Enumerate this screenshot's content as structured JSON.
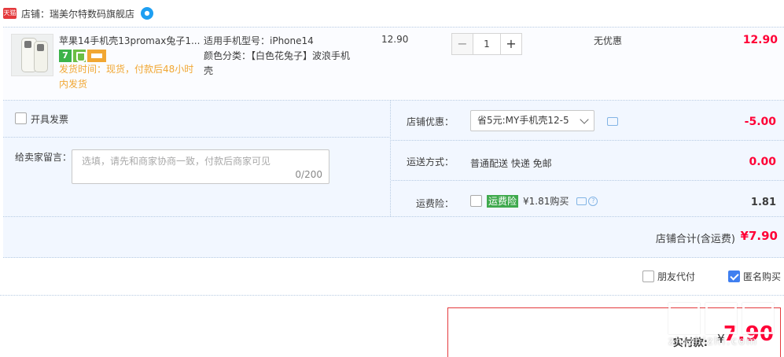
{
  "shop": {
    "badge": "天猫",
    "label": "店铺：瑞美尔特数码旗舰店",
    "wangwang_icon": "chat-bubble-icon"
  },
  "item": {
    "title": "苹果14手机壳13promax兔子1...",
    "badge_7": "7",
    "ship_time": "发货时间：现货，付款后48小时内发货",
    "attr_model": "适用手机型号：iPhone14",
    "attr_color": "颜色分类：【白色花兔子】波浪手机壳",
    "unit_price": "12.90",
    "qty": "1",
    "qty_minus": "−",
    "qty_plus": "+",
    "discount": "无优惠",
    "subtotal": "12.90"
  },
  "options": {
    "invoice_label": "开具发票",
    "message_label": "给卖家留言：",
    "message_placeholder": "选填，请先和商家协商一致，付款后商家可见",
    "message_count": "0/200",
    "coupon_label": "店铺优惠：",
    "coupon_value": "省5元:MY手机壳12-5",
    "coupon_amount": "-5.00",
    "shipping_label": "运送方式：",
    "shipping_value": "普通配送 快递 免邮",
    "shipping_amount": "0.00",
    "insurance_label": "运费险：",
    "insurance_tag": "运费险",
    "insurance_price": "¥1.81购买",
    "insurance_amount": "1.81",
    "shop_total_label": "店铺合计(含运费)",
    "shop_total_amount": "¥7.90"
  },
  "pay_options": {
    "friend_pay": "朋友代付",
    "anonymous": "匿名购买",
    "anonymous_checked": true
  },
  "payment": {
    "label": "实付款:",
    "yen": "¥",
    "amount": "7.90"
  },
  "watermark": {
    "text": "zhizhizhi.com"
  },
  "colors": {
    "price_red": "#ff0036",
    "tmall_red": "#e4393c",
    "row_blue": "#f2f7ff",
    "link_blue": "#3f7ff0",
    "ship_orange": "#f1a733",
    "insurance_green": "#3fa94d"
  }
}
